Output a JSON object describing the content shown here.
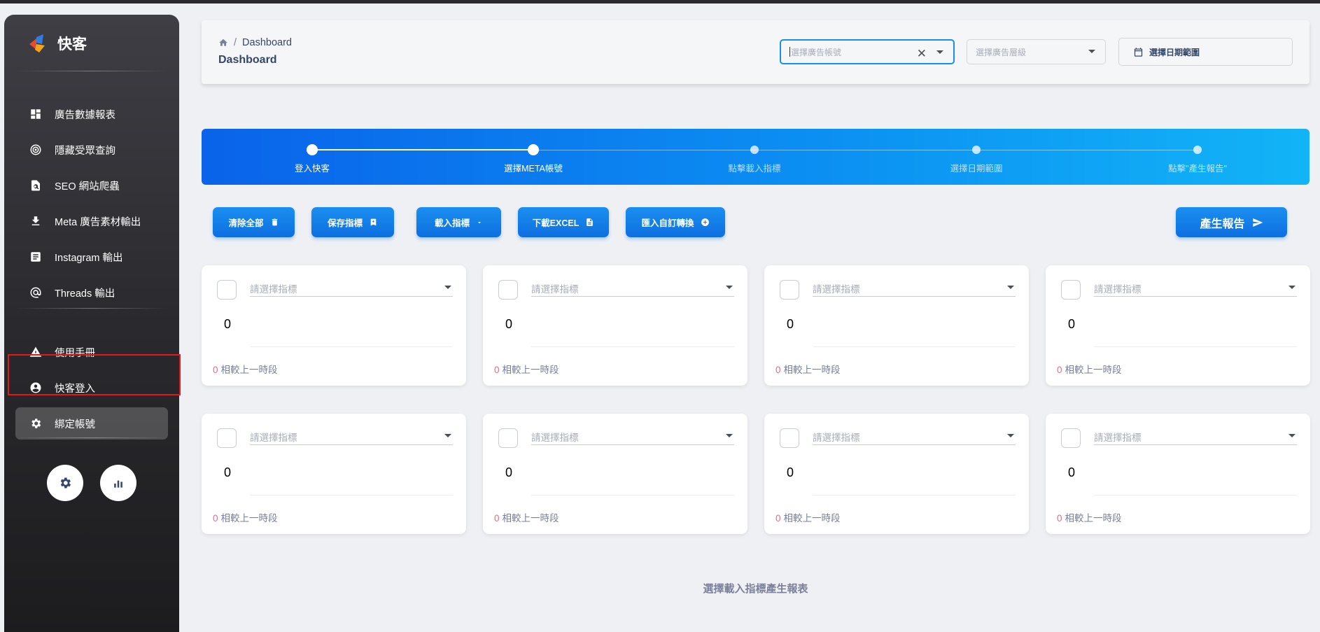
{
  "brand": {
    "name": "快客"
  },
  "sidebar": {
    "items": [
      {
        "label": "廣告數據報表",
        "icon": "dashboard-icon"
      },
      {
        "label": "隱藏受眾查詢",
        "icon": "target-icon"
      },
      {
        "label": "SEO 網站爬蟲",
        "icon": "doc-search-icon"
      },
      {
        "label": "Meta 廣告素材輸出",
        "icon": "download-icon"
      },
      {
        "label": "Instagram 輸出",
        "icon": "article-icon"
      },
      {
        "label": "Threads 輸出",
        "icon": "at-icon"
      },
      {
        "label": "使用手冊",
        "icon": "warning-icon"
      },
      {
        "label": "快客登入",
        "icon": "account-circle-icon"
      },
      {
        "label": "綁定帳號",
        "icon": "gear-icon"
      }
    ],
    "bottom_buttons": [
      "gear-icon",
      "bar-chart-icon"
    ]
  },
  "header": {
    "breadcrumb": "Dashboard",
    "title": "Dashboard",
    "ad_account_placeholder": "選擇廣告帳號",
    "ad_level_placeholder": "選擇廣告層級",
    "date_range_label": "選擇日期範圍"
  },
  "stepper": {
    "steps": [
      {
        "label": "登入快客",
        "done": true
      },
      {
        "label": "選擇META帳號",
        "done": true
      },
      {
        "label": "點擊載入指標",
        "done": false
      },
      {
        "label": "選擇日期範圍",
        "done": false
      },
      {
        "label": "點擊\"產生報告\"",
        "done": false
      }
    ]
  },
  "actions": {
    "clear_all": "清除全部",
    "save_metrics": "保存指標",
    "load_metrics": "載入指標",
    "download_excel": "下載EXCEL",
    "import_custom": "匯入自訂轉換",
    "generate_report": "產生報告"
  },
  "metric_card": {
    "placeholder": "請選擇指標",
    "value": "0",
    "change": "0",
    "compare_label": "相較上一時段"
  },
  "footer_note": "選擇載入指標產生報表",
  "colors": {
    "primary": "#0d6fe0",
    "sidebar": "#2a2a2e",
    "highlight": "#e01a1a",
    "change_number": "#e06d8a"
  }
}
